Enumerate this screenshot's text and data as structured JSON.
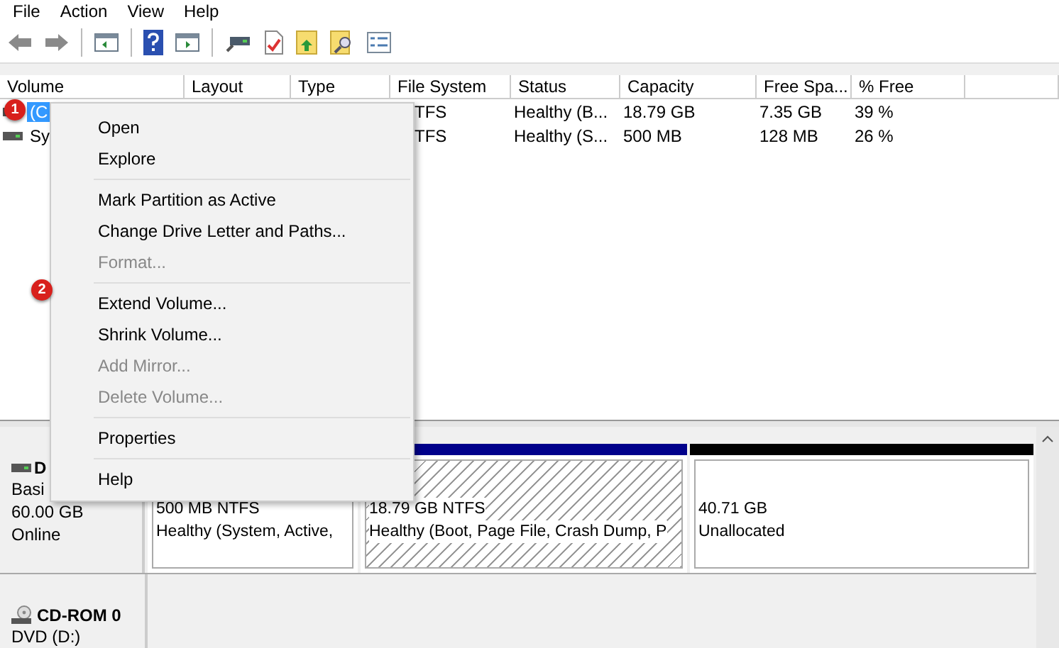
{
  "menu_bar": [
    "File",
    "Action",
    "View",
    "Help"
  ],
  "volume_list": {
    "columns": [
      "Volume",
      "Layout",
      "Type",
      "File System",
      "Status",
      "Capacity",
      "Free Spa...",
      "% Free",
      ""
    ],
    "rows": [
      {
        "selected": true,
        "cells": [
          "(C",
          "",
          "",
          "TFS",
          "Healthy (B...",
          "18.79 GB",
          "7.35 GB",
          "39 %"
        ]
      },
      {
        "selected": false,
        "cells": [
          "Sy",
          "",
          "",
          "TFS",
          "Healthy (S...",
          "500 MB",
          "128 MB",
          "26 %"
        ]
      }
    ]
  },
  "disks": [
    {
      "kind": "disk",
      "name": "D",
      "lines": [
        "Basi",
        "60.00 GB",
        "Online"
      ],
      "partitions": [
        {
          "kind": "primary",
          "selected": false,
          "size": "500 MB NTFS",
          "status": "Healthy (System, Active,"
        },
        {
          "kind": "primary",
          "selected": true,
          "size": "18.79 GB NTFS",
          "status": "Healthy (Boot, Page File, Crash Dump, P"
        },
        {
          "kind": "unallocated",
          "selected": false,
          "size": "40.71 GB",
          "status": "Unallocated"
        }
      ]
    },
    {
      "kind": "cdrom",
      "name": "CD-ROM 0",
      "lines": [
        "DVD (D:)"
      ]
    }
  ],
  "context_menu": [
    {
      "kind": "item",
      "label": "Open",
      "disabled": false
    },
    {
      "kind": "item",
      "label": "Explore",
      "disabled": false
    },
    {
      "kind": "separator"
    },
    {
      "kind": "item",
      "label": "Mark Partition as Active",
      "disabled": false
    },
    {
      "kind": "item",
      "label": "Change Drive Letter and Paths...",
      "disabled": false
    },
    {
      "kind": "item",
      "label": "Format...",
      "disabled": true
    },
    {
      "kind": "separator"
    },
    {
      "kind": "item",
      "label": "Extend Volume...",
      "disabled": false,
      "badge": "2"
    },
    {
      "kind": "item",
      "label": "Shrink Volume...",
      "disabled": false
    },
    {
      "kind": "item",
      "label": "Add Mirror...",
      "disabled": true
    },
    {
      "kind": "item",
      "label": "Delete Volume...",
      "disabled": true
    },
    {
      "kind": "separator"
    },
    {
      "kind": "item",
      "label": "Properties",
      "disabled": false
    },
    {
      "kind": "separator"
    },
    {
      "kind": "item",
      "label": "Help",
      "disabled": false
    }
  ],
  "step_badge": "1"
}
